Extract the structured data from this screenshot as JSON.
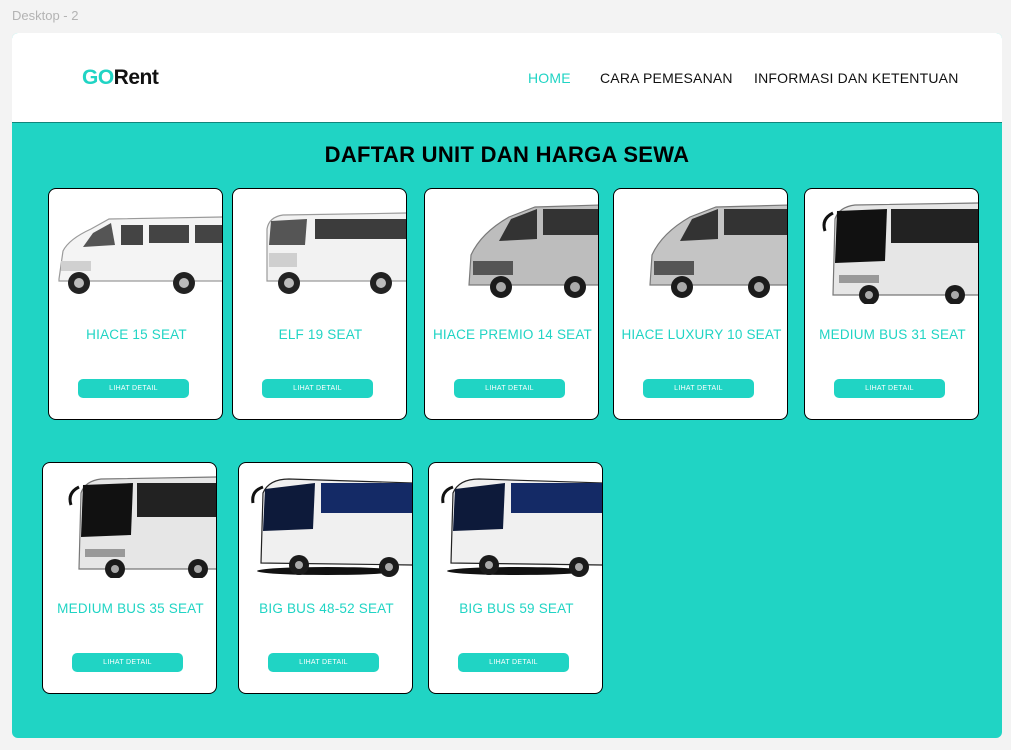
{
  "frame_label": "Desktop - 2",
  "header": {
    "logo_part1": "GO",
    "logo_part2": "Rent",
    "nav": [
      "HOME",
      "CARA PEMESANAN",
      "INFORMASI DAN KETENTUAN"
    ]
  },
  "section_title": "DAFTAR UNIT DAN HARGA SEWA",
  "button_label": "LIHAT DETAIL",
  "units": [
    {
      "name": "HIACE 15 SEAT",
      "image": "white-minibus"
    },
    {
      "name": "ELF 19 SEAT",
      "image": "white-van-boxy"
    },
    {
      "name": "HIACE PREMIO 14 SEAT",
      "image": "silver-van"
    },
    {
      "name": "HIACE LUXURY 10 SEAT",
      "image": "silver-van"
    },
    {
      "name": "MEDIUM BUS 31 SEAT",
      "image": "white-coach-bus"
    },
    {
      "name": "MEDIUM BUS 35 SEAT",
      "image": "white-coach-bus"
    },
    {
      "name": "BIG BUS 48-52 SEAT",
      "image": "blue-big-bus"
    },
    {
      "name": "BIG BUS 59 SEAT",
      "image": "blue-big-bus"
    }
  ],
  "colors": {
    "accent": "#20d4c4",
    "text": "#111111",
    "background": "#f3f3f3"
  }
}
